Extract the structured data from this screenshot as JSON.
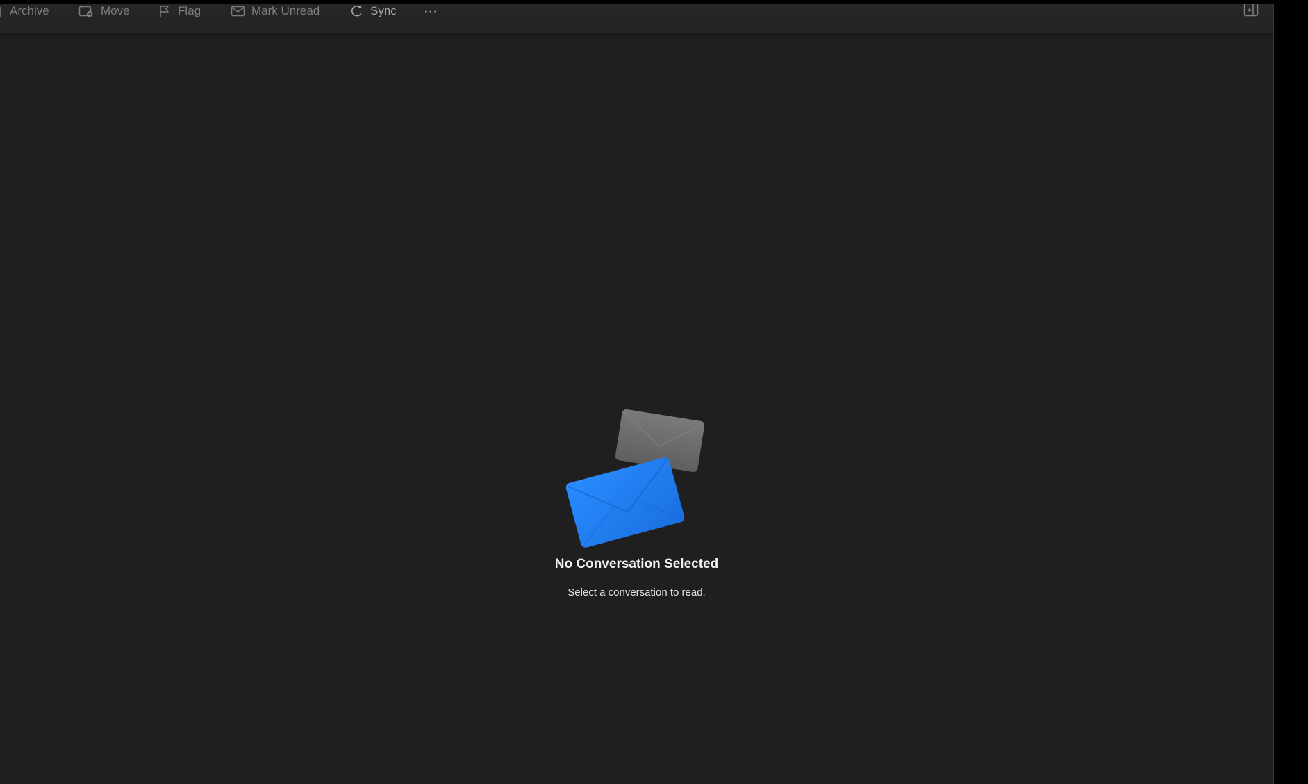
{
  "toolbar": {
    "archive_label": "Archive",
    "move_label": "Move",
    "flag_label": "Flag",
    "mark_unread_label": "Mark Unread",
    "sync_label": "Sync",
    "more_label": "···"
  },
  "empty_state": {
    "title": "No Conversation Selected",
    "subtitle": "Select a conversation to read."
  },
  "colors": {
    "background": "#1f1f20",
    "toolbar_text": "#7d7d82",
    "envelope_front": "#1f7ff0",
    "envelope_back": "#6b6b6e"
  },
  "icons": {
    "move": "folder-move-icon",
    "flag": "flag-icon",
    "mark_unread": "envelope-icon",
    "sync": "sync-icon",
    "more": "ellipsis-icon",
    "sidebar": "sidebar-toggle-icon",
    "illustration": "envelopes-illustration"
  }
}
